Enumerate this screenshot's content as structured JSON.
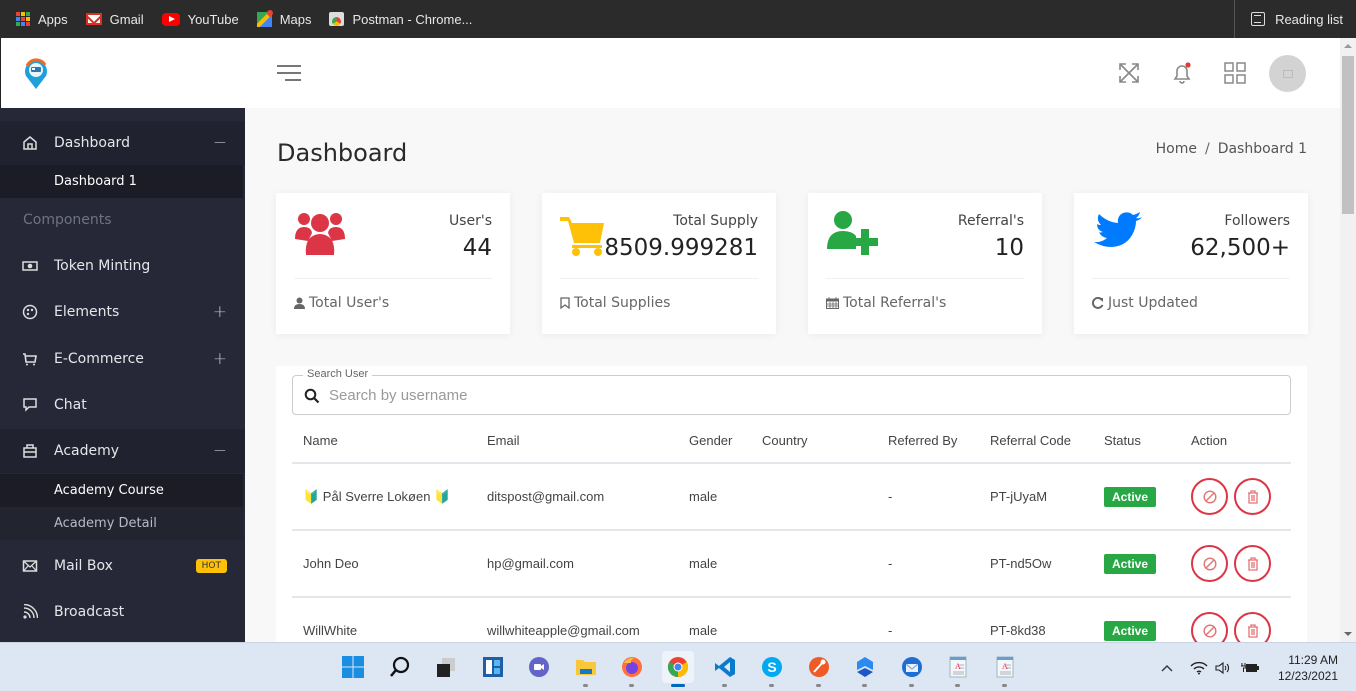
{
  "browser": {
    "bookmarks": [
      {
        "label": "Apps",
        "icon": "apps-grid-icon"
      },
      {
        "label": "Gmail",
        "icon": "gmail-icon"
      },
      {
        "label": "YouTube",
        "icon": "youtube-icon"
      },
      {
        "label": "Maps",
        "icon": "maps-icon"
      },
      {
        "label": "Postman - Chrome...",
        "icon": "postman-icon"
      }
    ],
    "reading_list": "Reading list"
  },
  "topbar": {
    "icons": [
      "fullscreen-icon",
      "bell-icon",
      "apps-icon",
      "avatar"
    ],
    "notification_dot_color": "#e53935"
  },
  "sidebar": {
    "items": [
      {
        "label": "Dashboard",
        "icon": "home-icon",
        "toggle": "−",
        "expanded": true
      },
      {
        "label": "Dashboard 1",
        "sub": true,
        "active": true
      },
      {
        "heading": "Components"
      },
      {
        "label": "Token Minting",
        "icon": "money-icon"
      },
      {
        "label": "Elements",
        "icon": "palette-icon",
        "toggle": "+"
      },
      {
        "label": "E-Commerce",
        "icon": "cart-icon",
        "toggle": "+"
      },
      {
        "label": "Chat",
        "icon": "chat-icon"
      },
      {
        "label": "Academy",
        "icon": "briefcase-icon",
        "toggle": "−",
        "expanded": true
      },
      {
        "label": "Academy Course",
        "sub": true,
        "active": true
      },
      {
        "label": "Academy Detail",
        "sub": true
      },
      {
        "label": "Mail Box",
        "icon": "mail-icon",
        "badge": "HOT"
      },
      {
        "label": "Broadcast",
        "icon": "rss-icon"
      }
    ]
  },
  "header": {
    "title": "Dashboard",
    "breadcrumb": [
      "Home",
      "Dashboard 1"
    ],
    "breadcrumb_sep": "/"
  },
  "stats": [
    {
      "label": "User's",
      "value": "44",
      "footer": "Total User's",
      "icon": "users-icon",
      "footer_icon": "user-icon",
      "color": "#dc3545"
    },
    {
      "label": "Total Supply",
      "value": "8509.999281",
      "footer": "Total Supplies",
      "icon": "cart-icon",
      "footer_icon": "bookmark-icon",
      "color": "#ffc107"
    },
    {
      "label": "Referral's",
      "value": "10",
      "footer": "Total Referral's",
      "icon": "user-plus-icon",
      "footer_icon": "calendar-icon",
      "color": "#28a745"
    },
    {
      "label": "Followers",
      "value": "62,500+",
      "footer": "Just Updated",
      "icon": "twitter-icon",
      "footer_icon": "refresh-icon",
      "color": "#007bff"
    }
  ],
  "search": {
    "legend": "Search User",
    "placeholder": "Search by username",
    "value": ""
  },
  "table": {
    "columns": [
      "Name",
      "Email",
      "Gender",
      "Country",
      "Referred By",
      "Referral Code",
      "Status",
      "Action"
    ],
    "rows": [
      {
        "name": "🔰 Pål Sverre Lokøen 🔰",
        "email": "ditspost@gmail.com",
        "gender": "male",
        "country": "",
        "referred_by": "-",
        "referral_code": "PT-jUyaM",
        "status": "Active"
      },
      {
        "name": "John Deo",
        "email": "hp@gmail.com",
        "gender": "male",
        "country": "",
        "referred_by": "-",
        "referral_code": "PT-nd5Ow",
        "status": "Active"
      },
      {
        "name": "WillWhite",
        "email": "willwhiteapple@gmail.com",
        "gender": "male",
        "country": "",
        "referred_by": "-",
        "referral_code": "PT-8kd38",
        "status": "Active"
      }
    ],
    "actions": [
      "block-icon",
      "trash-icon"
    ],
    "status_color": "#28a745",
    "action_color": "#dc3545"
  },
  "taskbar": {
    "apps": [
      "windows-start-icon",
      "search-icon",
      "task-view-icon",
      "widgets-icon",
      "teams-chat-icon",
      "file-explorer-icon",
      "firefox-icon",
      "chrome-icon",
      "vscode-icon",
      "skype-icon",
      "postman-icon",
      "app-icon",
      "thunderbird-icon",
      "document-icon",
      "document-icon"
    ],
    "time": "11:29 AM",
    "date": "12/23/2021"
  }
}
